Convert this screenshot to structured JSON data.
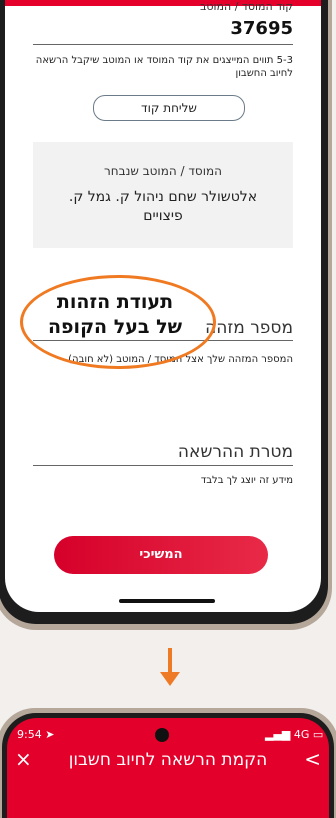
{
  "form": {
    "fund_label": "קוד המוסד / המוטב",
    "fund_code": "37695",
    "fund_hint": "5-3 תווים המייצגים את קוד המוסד או המוטב שיקבל הרשאה לחיוב החשבון",
    "send_code_button": "שליחת קוד",
    "selected_label": "המוסד / המוטב שנבחר",
    "selected_value": "אלטשולר שחם ניהול ק. גמל ק. פיצויים",
    "id_label": "מספר מזהה",
    "id_hint": "המספר המזהה שלך אצל המוסד / המוטב (לא חובה)",
    "purpose_label": "מטרת ההרשאה",
    "purpose_hint": "מידע זה יוצג לך בלבד",
    "continue_button": "המשיכי"
  },
  "annotation": {
    "line1": "תעודת הזהות",
    "line2": "של בעל הקופה"
  },
  "second_screen": {
    "time": "9:54",
    "network": "4G",
    "title": "הקמת הרשאה לחיוב חשבון",
    "close_icon": "×",
    "back_icon": ">"
  },
  "colors": {
    "brand_red": "#e4002b",
    "annotation_orange": "#f07a22"
  }
}
